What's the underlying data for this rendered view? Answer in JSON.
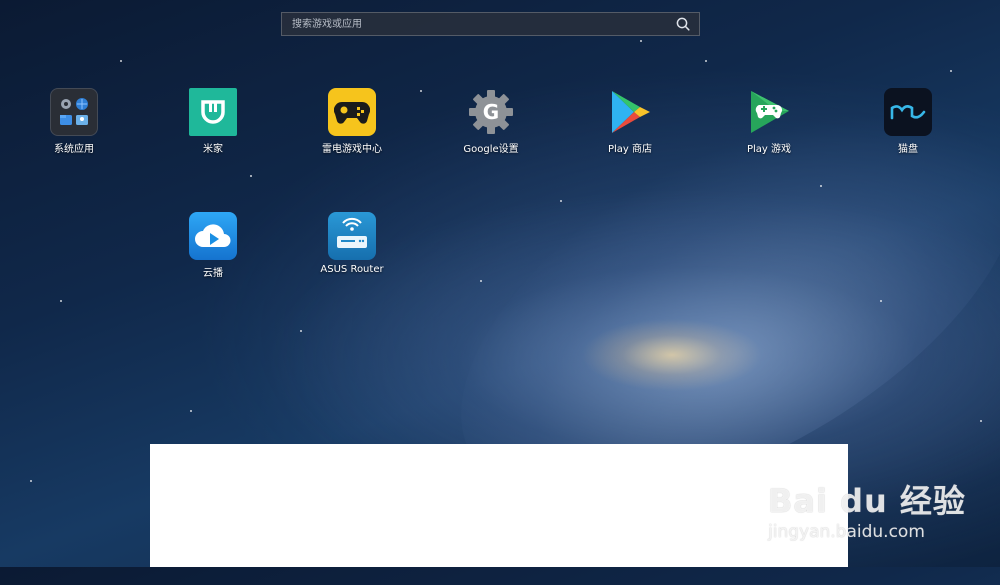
{
  "search": {
    "placeholder": "搜索游戏或应用"
  },
  "apps": [
    {
      "label": "系统应用",
      "icon": "system-apps-folder-icon"
    },
    {
      "label": "米家",
      "icon": "mijia-icon"
    },
    {
      "label": "雷电游戏中心",
      "icon": "ldplayer-game-center-icon"
    },
    {
      "label": "Google设置",
      "icon": "google-settings-gear-icon"
    },
    {
      "label": "Play 商店",
      "icon": "play-store-icon"
    },
    {
      "label": "Play 游戏",
      "icon": "play-games-icon"
    },
    {
      "label": "猫盘",
      "icon": "maopan-icon"
    },
    {
      "label": "云播",
      "icon": "cloud-play-icon"
    },
    {
      "label": "ASUS Router",
      "icon": "asus-router-icon"
    }
  ],
  "watermark": {
    "brand": "Bai du 经验",
    "url": "jingyan.baidu.com"
  },
  "colors": {
    "mijia": "#1fb89a",
    "ldplayer": "#f6c41c",
    "cloud": "#1a8fe3",
    "asus": "#1f88c8",
    "maopan": "#0b1220"
  }
}
